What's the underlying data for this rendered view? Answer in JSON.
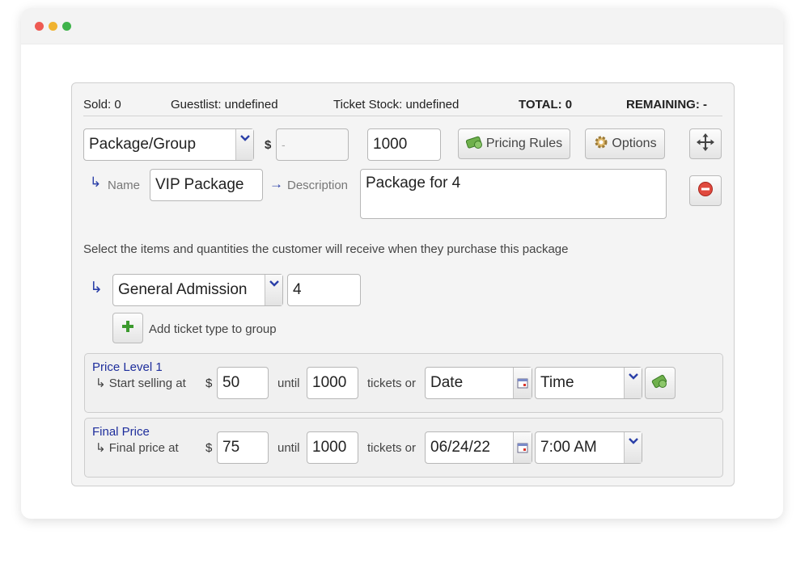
{
  "window": {
    "controls": [
      "close",
      "minimize",
      "maximize"
    ]
  },
  "stats": {
    "sold": "Sold: 0",
    "guestlist": "Guestlist: undefined",
    "ticket_stock": "Ticket Stock: undefined",
    "total": "TOTAL: 0",
    "remaining": "REMAINING: -"
  },
  "package": {
    "type_select": "Package/Group",
    "currency": "$",
    "price_placeholder": "-",
    "quantity": "1000",
    "pricing_rules_label": "Pricing Rules",
    "options_label": "Options",
    "name_label": "Name",
    "name_value": "VIP Package",
    "description_label": "Description",
    "description_value": "Package for 4"
  },
  "instructions": "Select the items and quantities the customer will receive when they purchase this package",
  "group_item": {
    "ticket_type": "General Admission",
    "quantity": "4",
    "add_label": "Add ticket type to group"
  },
  "price_levels": [
    {
      "title": "Price Level 1",
      "label": "Start selling at",
      "currency": "$",
      "price": "50",
      "until": "until",
      "tickets": "1000",
      "tickets_or": "tickets or",
      "date": "Date",
      "time": "Time"
    },
    {
      "title": "Final Price",
      "label": "Final price at",
      "currency": "$",
      "price": "75",
      "until": "until",
      "tickets": "1000",
      "tickets_or": "tickets or",
      "date": "06/24/22",
      "time": "7:00 AM"
    }
  ],
  "colors": {
    "accent_blue": "#1e2e9c",
    "add_green": "#3c9a2e",
    "remove_red": "#d9342b"
  }
}
